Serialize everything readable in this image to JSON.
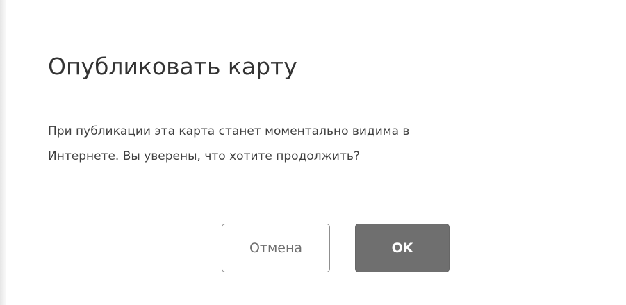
{
  "dialog": {
    "title": "Опубликовать карту",
    "message": "При публикации эта карта станет моментально видима в Интернете. Вы уверены, что хотите продолжить?",
    "cancel_label": "Отмена",
    "ok_label": "OK"
  },
  "colors": {
    "background": "#ffffff",
    "title_text": "#333333",
    "body_text": "#404040",
    "cancel_border": "#8f8f8f",
    "cancel_text": "#6f6f6f",
    "ok_background": "#6f6f6f",
    "ok_text": "#ffffff"
  }
}
